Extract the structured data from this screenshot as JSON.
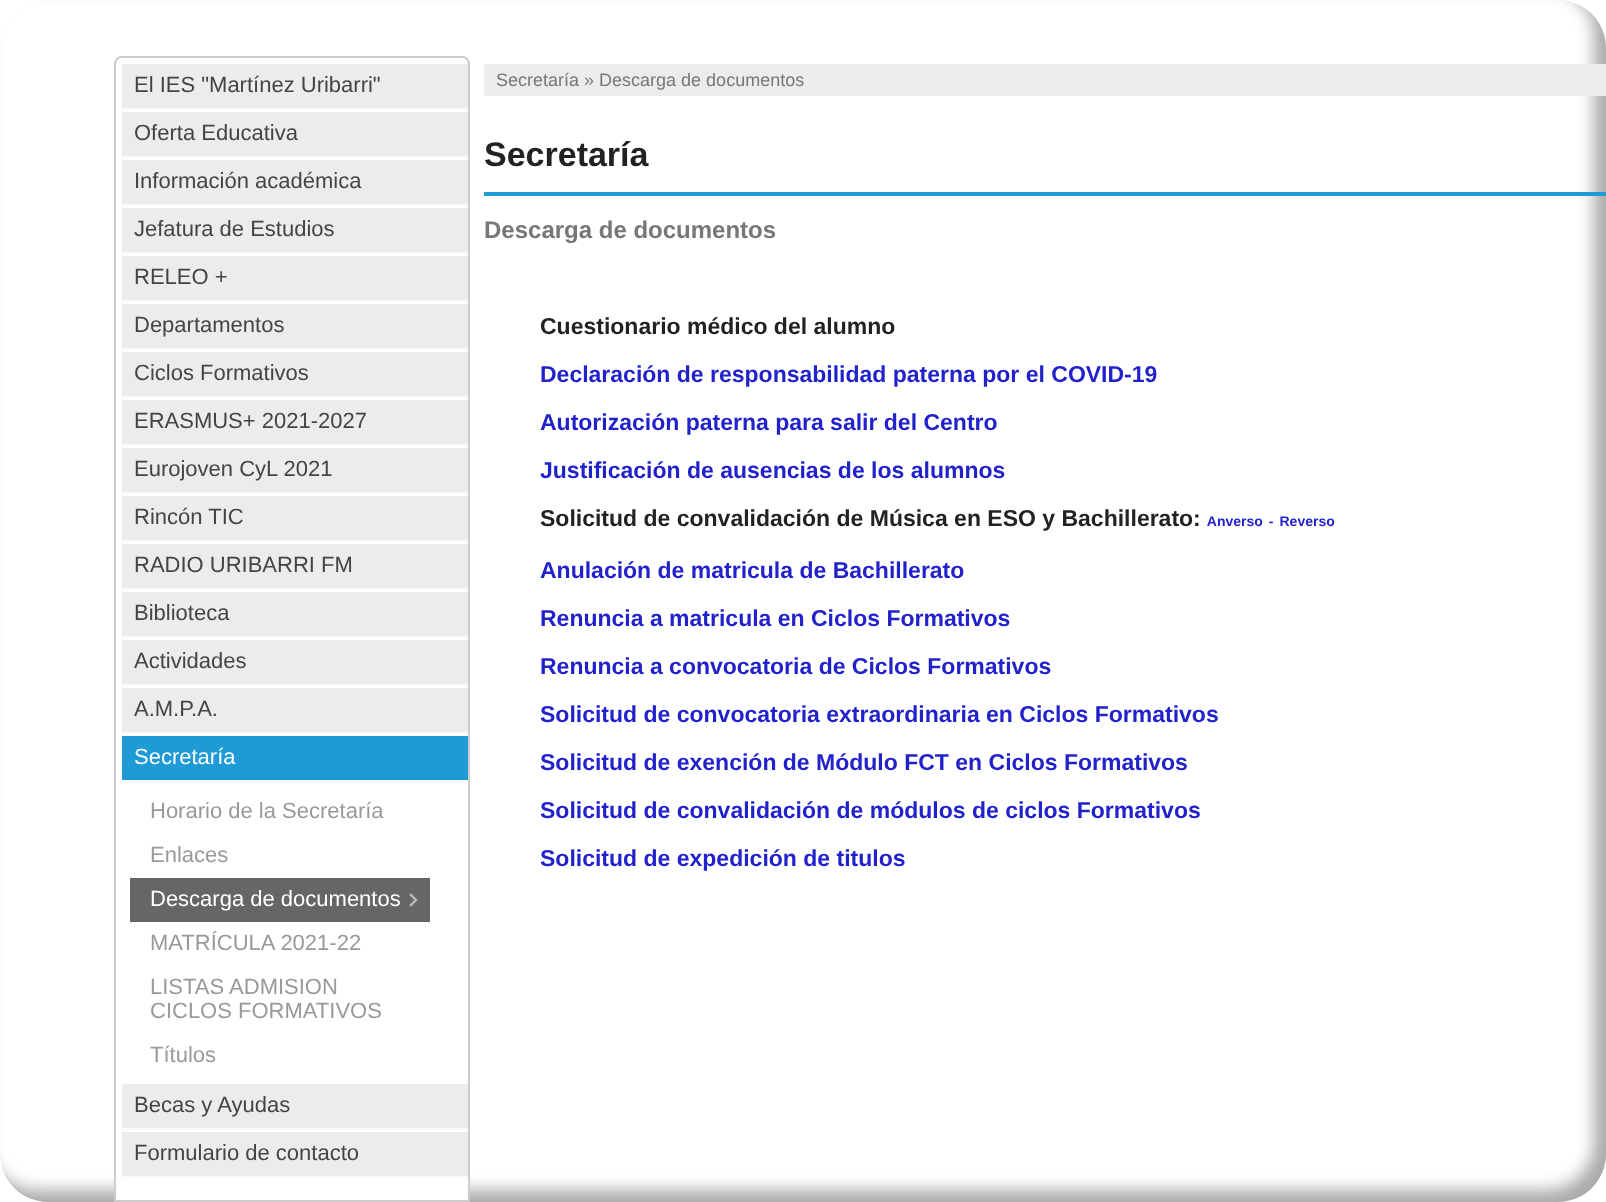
{
  "sidebar": {
    "items": [
      {
        "label": "El IES \"Martínez Uribarri\"",
        "selected": false
      },
      {
        "label": "Oferta Educativa",
        "selected": false
      },
      {
        "label": "Información académica",
        "selected": false
      },
      {
        "label": "Jefatura de Estudios",
        "selected": false
      },
      {
        "label": "RELEO +",
        "selected": false
      },
      {
        "label": "Departamentos",
        "selected": false
      },
      {
        "label": "Ciclos Formativos",
        "selected": false
      },
      {
        "label": "ERASMUS+ 2021-2027",
        "selected": false
      },
      {
        "label": "Eurojoven CyL 2021",
        "selected": false
      },
      {
        "label": "Rincón TIC",
        "selected": false
      },
      {
        "label": "RADIO URIBARRI FM",
        "selected": false
      },
      {
        "label": "Biblioteca",
        "selected": false
      },
      {
        "label": "Actividades",
        "selected": false
      },
      {
        "label": "A.M.P.A.",
        "selected": false
      },
      {
        "label": "Secretaría",
        "selected": true,
        "children": [
          {
            "label": "Horario de la Secretaría",
            "selected": false
          },
          {
            "label": "Enlaces",
            "selected": false
          },
          {
            "label": "Descarga de documentos",
            "selected": true
          },
          {
            "label": "MATRÍCULA 2021-22",
            "selected": false
          },
          {
            "label": "LISTAS ADMISION CICLOS FORMATIVOS",
            "selected": false
          },
          {
            "label": "Títulos",
            "selected": false
          }
        ]
      },
      {
        "label": "Becas y Ayudas",
        "selected": false
      },
      {
        "label": "Formulario de contacto",
        "selected": false
      }
    ]
  },
  "breadcrumb": "Secretaría » Descarga de documentos",
  "title": "Secretaría",
  "subtitle": "Descarga de documentos",
  "documents": [
    {
      "kind": "text",
      "label": "Cuestionario médico del alumno"
    },
    {
      "kind": "link",
      "label": "Declaración de responsabilidad paterna por el COVID-19"
    },
    {
      "kind": "link",
      "label": "Autorización paterna para salir del Centro"
    },
    {
      "kind": "link",
      "label": "Justificación de ausencias de los alumnos"
    },
    {
      "kind": "text",
      "label": "Solicitud de convalidación de Música en ESO y Bachillerato:",
      "extras": [
        "Anverso",
        "Reverso"
      ],
      "separator": "-"
    },
    {
      "kind": "link",
      "label": "Anulación de matricula de Bachillerato"
    },
    {
      "kind": "link",
      "label": "Renuncia a matricula en Ciclos Formativos"
    },
    {
      "kind": "link",
      "label": "Renuncia a convocatoria de Ciclos Formativos"
    },
    {
      "kind": "link",
      "label": "Solicitud de convocatoria extraordinaria en Ciclos Formativos"
    },
    {
      "kind": "link",
      "label": "Solicitud de exención de Módulo FCT en Ciclos Formativos"
    },
    {
      "kind": "link",
      "label": "Solicitud de convalidación de módulos de ciclos Formativos"
    },
    {
      "kind": "link",
      "label": "Solicitud de expedición de titulos"
    }
  ]
}
